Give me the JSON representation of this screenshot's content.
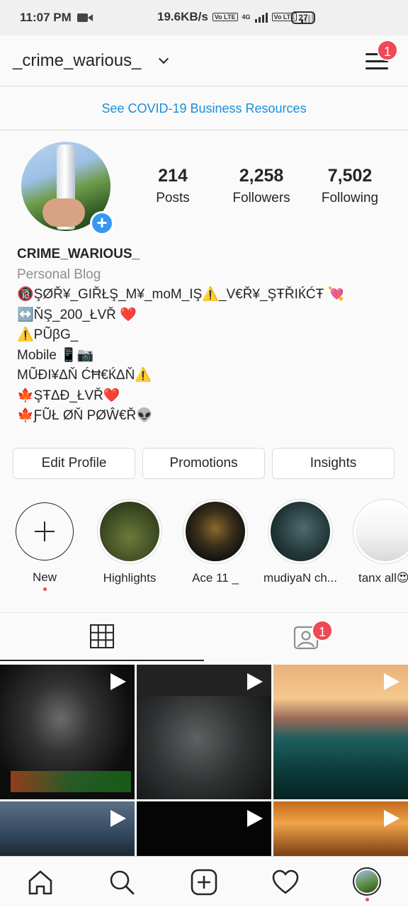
{
  "status_bar": {
    "time": "11:07 PM",
    "speed": "19.6KB/s",
    "network": "4G",
    "volte": "Vo LTE",
    "battery": "27"
  },
  "header": {
    "username": "_crime_warious_",
    "menu_badge": "1"
  },
  "banner": {
    "text": "See COVID-19 Business Resources"
  },
  "stats": [
    {
      "value": "214",
      "label": "Posts"
    },
    {
      "value": "2,258",
      "label": "Followers"
    },
    {
      "value": "7,502",
      "label": "Following"
    }
  ],
  "profile": {
    "name": "CRIME_WARIOUS_",
    "category": "Personal Blog",
    "bio_lines": [
      "🔞ŞØŘ¥_GIŘŁŞ_M¥_moM_IŞ⚠️_V€Ř¥_ŞŦŘIЌĆŦ 💘",
      "↔️ŇŞ_200_ŁVŘ ❤️",
      "⚠️PŨβG_",
      "Mobile 📱📷",
      "MŨĐI¥ΔŇ ĆĦ€ЌΔŇ⚠️",
      "🍁ŞŦΔĐ_ŁVŘ❤️",
      "🍁ƑŨŁ ØŇ PØŴ€Ř👽"
    ],
    "plus_icon": "+"
  },
  "buttons": {
    "edit_profile": "Edit Profile",
    "promotions": "Promotions",
    "insights": "Insights"
  },
  "highlights": {
    "new_label": "New",
    "items": [
      {
        "label": "Highlights"
      },
      {
        "label": "Ace 11 _"
      },
      {
        "label": "mudiyaN ch..."
      },
      {
        "label": "tanx all😍"
      }
    ]
  },
  "tabs": {
    "tagged_badge": "1"
  },
  "colors": {
    "accent": "#3897f0",
    "badge": "#ed4956",
    "link": "#1a8fdb"
  },
  "icons": [
    "video-camera-icon",
    "signal-icon",
    "chevron-down-icon",
    "menu-icon",
    "plus-icon",
    "grid-icon",
    "tagged-icon",
    "play-icon",
    "home-icon",
    "search-icon",
    "add-post-icon",
    "heart-icon",
    "profile-icon"
  ]
}
